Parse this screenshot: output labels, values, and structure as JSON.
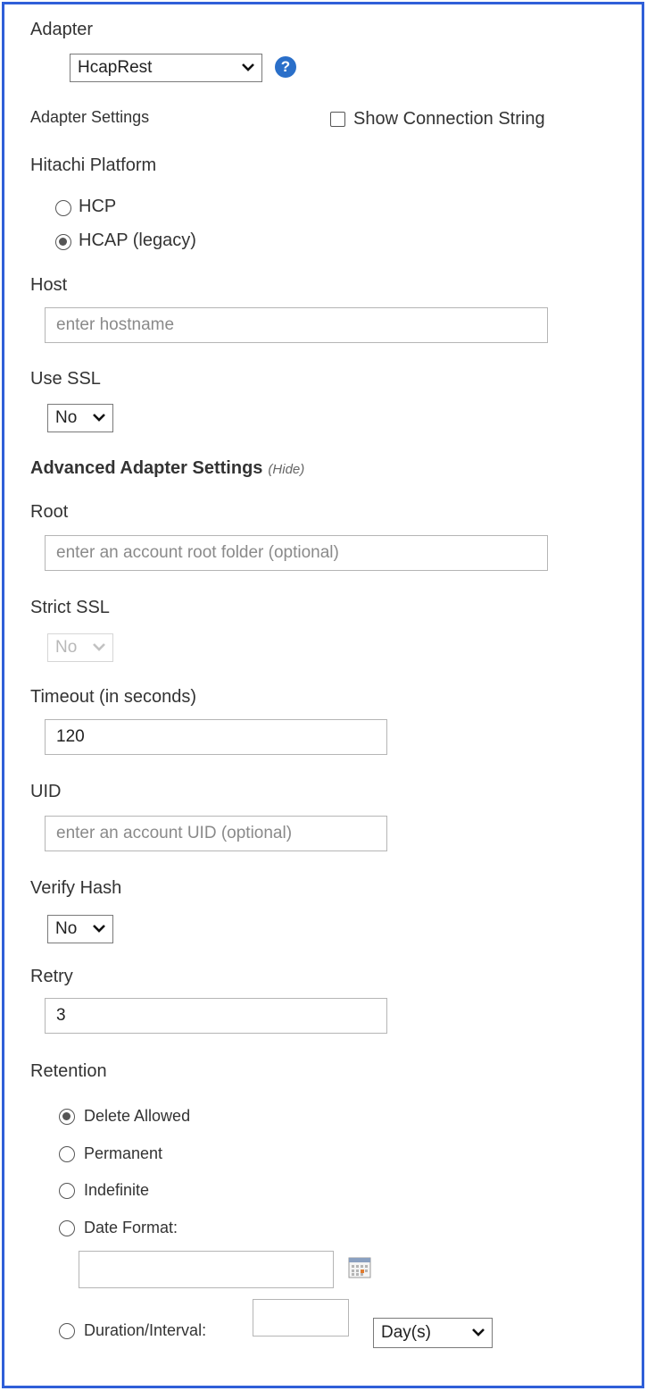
{
  "adapter": {
    "label": "Adapter",
    "selected": "HcapRest",
    "help_icon": "question-circle-icon"
  },
  "adapter_settings": {
    "label": "Adapter Settings",
    "show_connection_string_label": "Show Connection String",
    "show_connection_string_checked": false
  },
  "platform": {
    "label": "Hitachi Platform",
    "options": [
      {
        "label": "HCP",
        "checked": false
      },
      {
        "label": "HCAP (legacy)",
        "checked": true
      }
    ]
  },
  "host": {
    "label": "Host",
    "value": "",
    "placeholder": "enter hostname"
  },
  "use_ssl": {
    "label": "Use SSL",
    "selected": "No"
  },
  "advanced": {
    "title": "Advanced Adapter Settings",
    "toggle_label": "(Hide)"
  },
  "root": {
    "label": "Root",
    "value": "",
    "placeholder": "enter an account root folder (optional)"
  },
  "strict_ssl": {
    "label": "Strict SSL",
    "selected": "No",
    "disabled": true
  },
  "timeout": {
    "label": "Timeout (in seconds)",
    "value": "120"
  },
  "uid": {
    "label": "UID",
    "value": "",
    "placeholder": "enter an account UID (optional)"
  },
  "verify_hash": {
    "label": "Verify Hash",
    "selected": "No"
  },
  "retry": {
    "label": "Retry",
    "value": "3"
  },
  "retention": {
    "label": "Retention",
    "options": [
      {
        "label": "Delete Allowed",
        "checked": true
      },
      {
        "label": "Permanent",
        "checked": false
      },
      {
        "label": "Indefinite",
        "checked": false
      },
      {
        "label": "Date Format:",
        "checked": false
      },
      {
        "label": "Duration/Interval:",
        "checked": false
      }
    ],
    "date_value": "",
    "duration_value": "",
    "duration_unit": "Day(s)",
    "calendar_icon": "calendar-icon"
  },
  "colors": {
    "frame_border": "#2f5fd8",
    "help_icon": "#2a6fc9"
  }
}
